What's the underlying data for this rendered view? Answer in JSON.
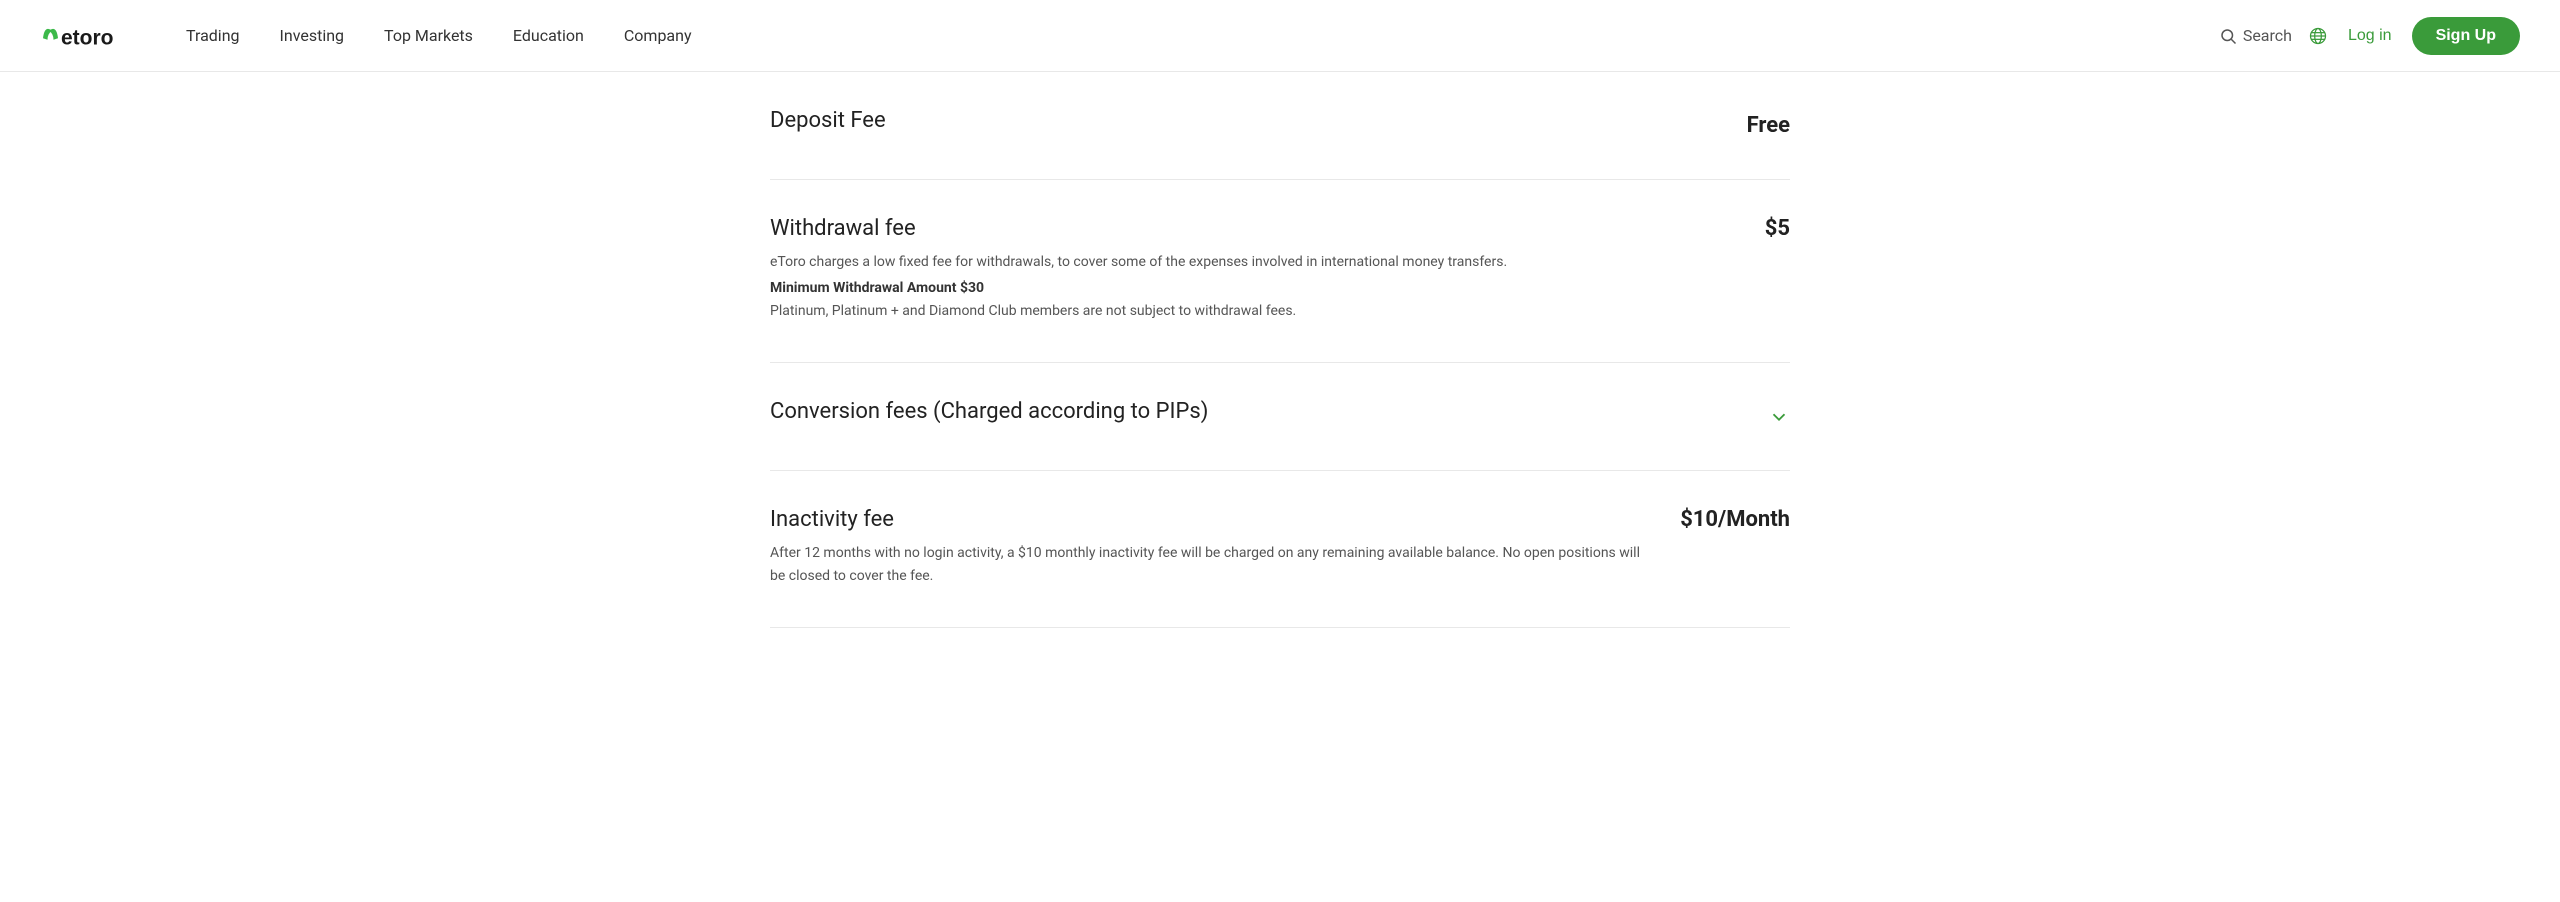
{
  "logo": {
    "alt": "eToro"
  },
  "navbar": {
    "items": [
      {
        "label": "Trading",
        "active": false
      },
      {
        "label": "Investing",
        "active": false
      },
      {
        "label": "Top Markets",
        "active": false
      },
      {
        "label": "Education",
        "active": false
      },
      {
        "label": "Company",
        "active": false
      }
    ],
    "search_label": "Search",
    "login_label": "Log in",
    "signup_label": "Sign Up"
  },
  "fees": {
    "deposit": {
      "title": "Deposit Fee",
      "value": "Free"
    },
    "withdrawal": {
      "title": "Withdrawal fee",
      "value": "$5",
      "desc1": "eToro charges a low fixed fee for withdrawals, to cover some of the expenses involved in international money transfers.",
      "desc_bold": "Minimum Withdrawal Amount $30",
      "desc2": "Platinum, Platinum + and Diamond Club members are not subject to withdrawal fees."
    },
    "conversion": {
      "title": "Conversion fees (Charged according to PIPs)"
    },
    "inactivity": {
      "title": "Inactivity fee",
      "value": "$10/Month",
      "desc": "After 12 months with no login activity, a $10 monthly inactivity fee will be charged on any remaining available balance. No open positions will be closed to cover the fee."
    }
  }
}
